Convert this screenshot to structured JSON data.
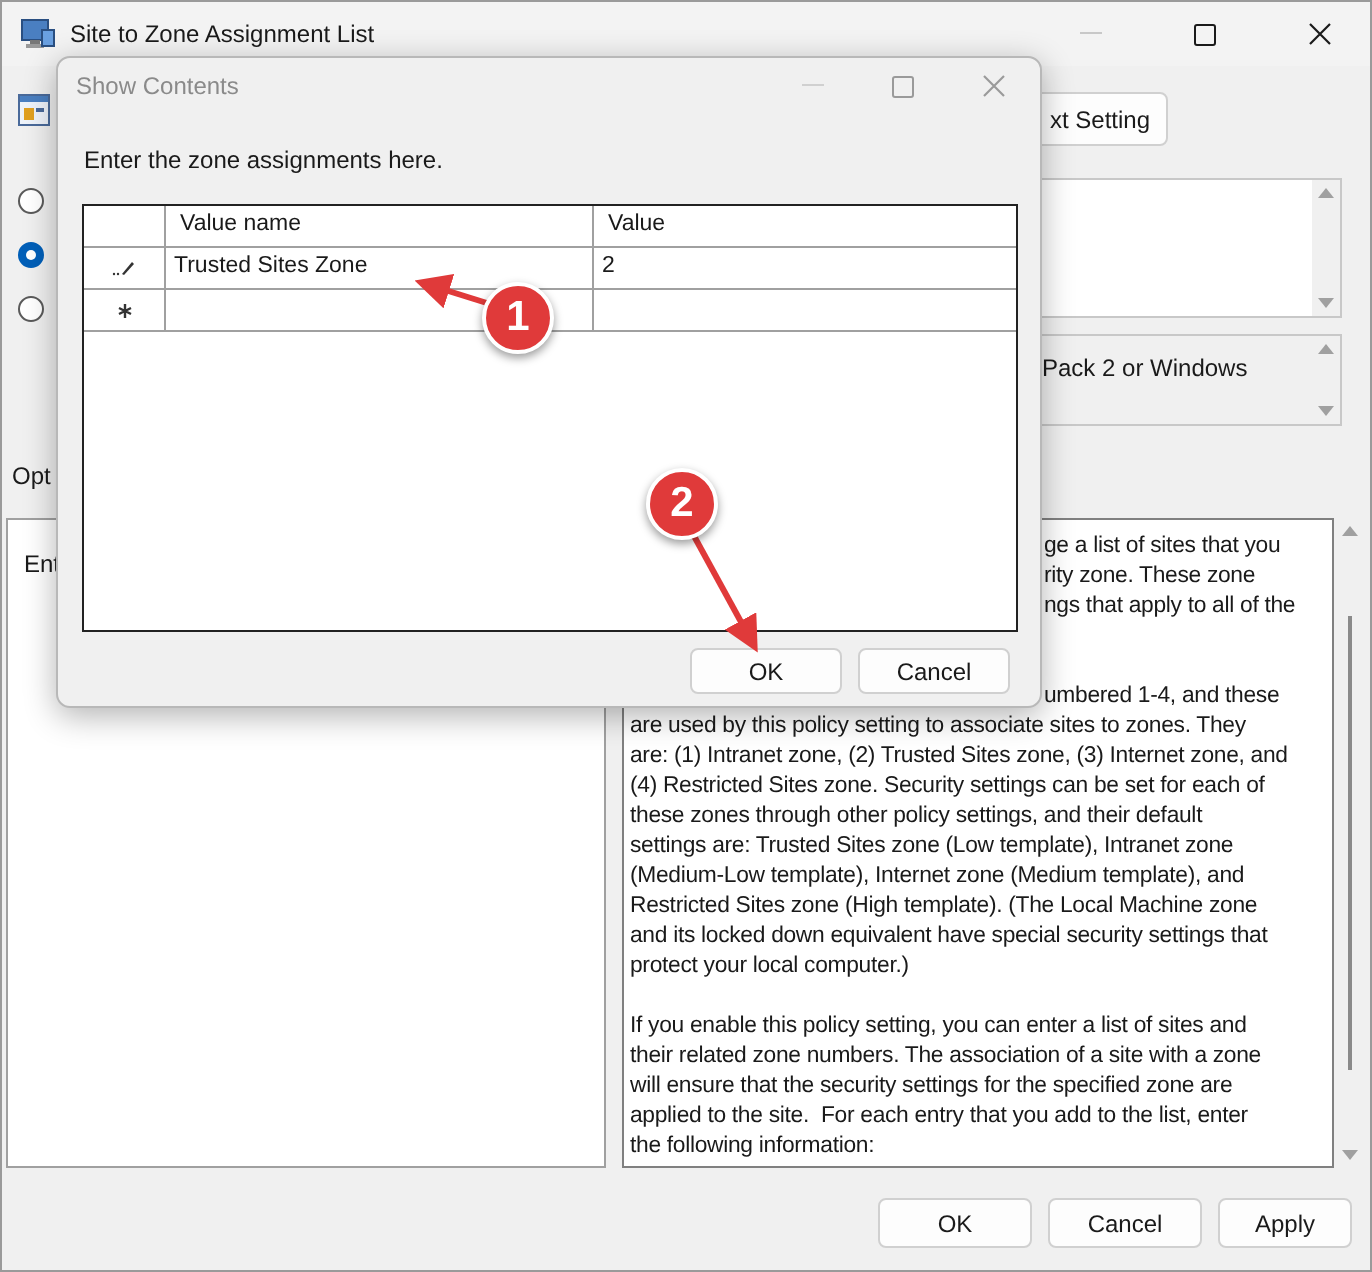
{
  "window": {
    "title": "Site to Zone Assignment List"
  },
  "radios": [
    {
      "selected": false
    },
    {
      "selected": true
    },
    {
      "selected": false
    }
  ],
  "next_setting_button": "xt Setting",
  "supported_on_text": "Pack 2 or Windows",
  "options_label": "Opt",
  "options_panel_text": "Ent",
  "help_text": {
    "covered_lines": [
      "ge a list of sites that you",
      "rity zone. These zone",
      "ngs that apply to all of the"
    ],
    "covered_line_lower": "umbered 1-4, and these",
    "paragraph_1": [
      "are used by this policy setting to associate sites to zones. They",
      "are: (1) Intranet zone, (2) Trusted Sites zone, (3) Internet zone, and",
      "(4) Restricted Sites zone. Security settings can be set for each of",
      "these zones through other policy settings, and their default",
      "settings are: Trusted Sites zone (Low template), Intranet zone",
      "(Medium-Low template), Internet zone (Medium template), and",
      "Restricted Sites zone (High template). (The Local Machine zone",
      "and its locked down equivalent have special security settings that",
      "protect your local computer.)"
    ],
    "paragraph_2": [
      "If you enable this policy setting, you can enter a list of sites and",
      "their related zone numbers. The association of a site with a zone",
      "will ensure that the security settings for the specified zone are",
      "applied to the site.  For each entry that you add to the list, enter",
      "the following information:"
    ]
  },
  "buttons": [
    "OK",
    "Cancel",
    "Apply"
  ],
  "dialog": {
    "title": "Show Contents",
    "prompt": "Enter the zone assignments here.",
    "table": {
      "columns": [
        "Value name",
        "Value"
      ],
      "rows": [
        {
          "kind": "editing",
          "cells": [
            "Trusted Sites Zone",
            "2"
          ]
        },
        {
          "kind": "new",
          "cells": []
        }
      ]
    },
    "buttons": [
      "OK",
      "Cancel"
    ]
  },
  "annotations": [
    {
      "number": "1"
    },
    {
      "number": "2"
    }
  ]
}
